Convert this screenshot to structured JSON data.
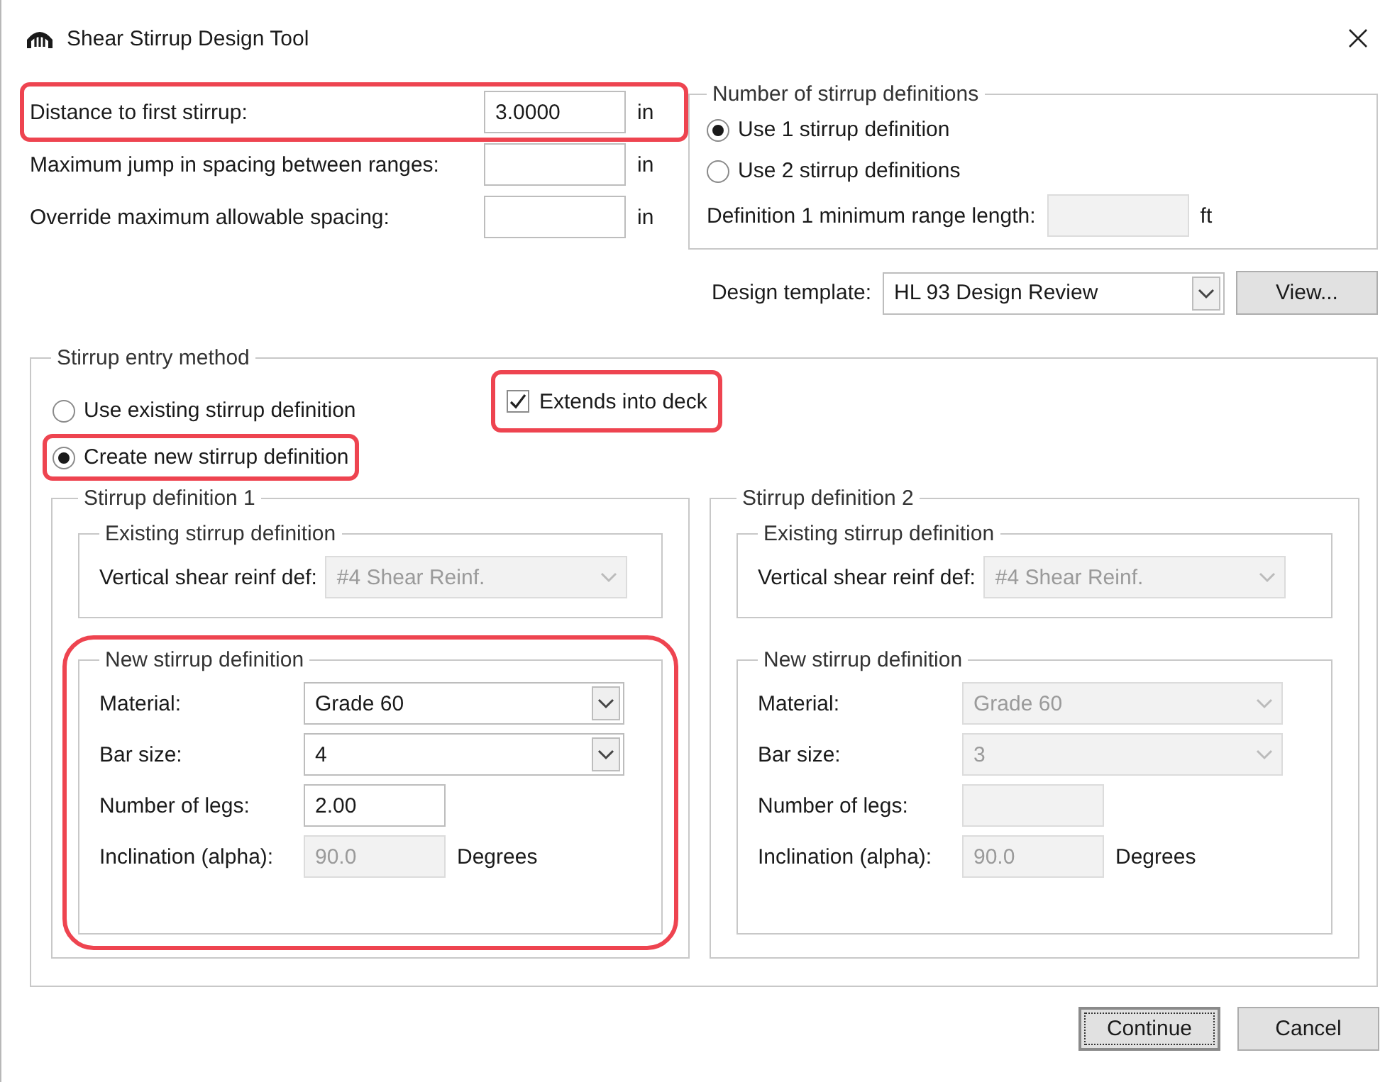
{
  "window": {
    "title": "Shear Stirrup Design Tool"
  },
  "spacing_fields": [
    {
      "label": "Distance to first stirrup:",
      "value": "3.0000",
      "unit": "in",
      "highlighted": true
    },
    {
      "label": "Maximum jump in spacing between ranges:",
      "unit": "in",
      "highlighted": false
    },
    {
      "label": "Override maximum allowable spacing:",
      "unit": "in",
      "highlighted": false
    }
  ],
  "number_of_definitions": {
    "title": "Number of stirrup definitions",
    "options": [
      {
        "label": "Use 1 stirrup definition",
        "selected": true
      },
      {
        "label": "Use 2 stirrup definitions",
        "selected": false
      }
    ],
    "min_range": {
      "label": "Definition 1 minimum range length:",
      "unit": "ft",
      "disabled": true
    }
  },
  "design_template": {
    "label": "Design template:",
    "value": "HL 93 Design Review",
    "button": "View..."
  },
  "entry_method": {
    "title": "Stirrup entry method",
    "options": [
      {
        "label": "Use existing stirrup definition",
        "selected": false,
        "highlighted": false
      },
      {
        "label": "Create new stirrup definition",
        "selected": true,
        "highlighted": true
      }
    ],
    "extends_into_deck": {
      "label": "Extends into deck",
      "checked": true,
      "highlighted": true
    },
    "definitions": [
      {
        "title": "Stirrup definition 1",
        "existing": {
          "title": "Existing stirrup definition",
          "label": "Vertical shear reinf def:",
          "value": "#4 Shear Reinf.",
          "disabled": true
        },
        "new": {
          "title": "New stirrup definition",
          "highlighted": true,
          "fields": [
            {
              "kind": "dropdown",
              "label": "Material:",
              "value": "Grade 60",
              "disabled": false
            },
            {
              "kind": "dropdown",
              "label": "Bar size:",
              "value": "4",
              "disabled": false
            },
            {
              "kind": "text",
              "label": "Number of legs:",
              "value": "2.00",
              "disabled": false
            },
            {
              "kind": "text",
              "label": "Inclination (alpha):",
              "value": "90.0",
              "unit": "Degrees",
              "disabled": true
            }
          ]
        }
      },
      {
        "title": "Stirrup definition 2",
        "existing": {
          "title": "Existing stirrup definition",
          "label": "Vertical shear reinf def:",
          "value": "#4 Shear Reinf.",
          "disabled": true
        },
        "new": {
          "title": "New stirrup definition",
          "highlighted": false,
          "fields": [
            {
              "kind": "dropdown",
              "label": "Material:",
              "value": "Grade 60",
              "disabled": true
            },
            {
              "kind": "dropdown",
              "label": "Bar size:",
              "value": "3",
              "disabled": true
            },
            {
              "kind": "text",
              "label": "Number of legs:",
              "disabled": true
            },
            {
              "kind": "text",
              "label": "Inclination (alpha):",
              "value": "90.0",
              "unit": "Degrees",
              "disabled": true
            }
          ]
        }
      }
    ]
  },
  "buttons": [
    {
      "label": "Continue",
      "default": true
    },
    {
      "label": "Cancel",
      "default": false
    }
  ]
}
